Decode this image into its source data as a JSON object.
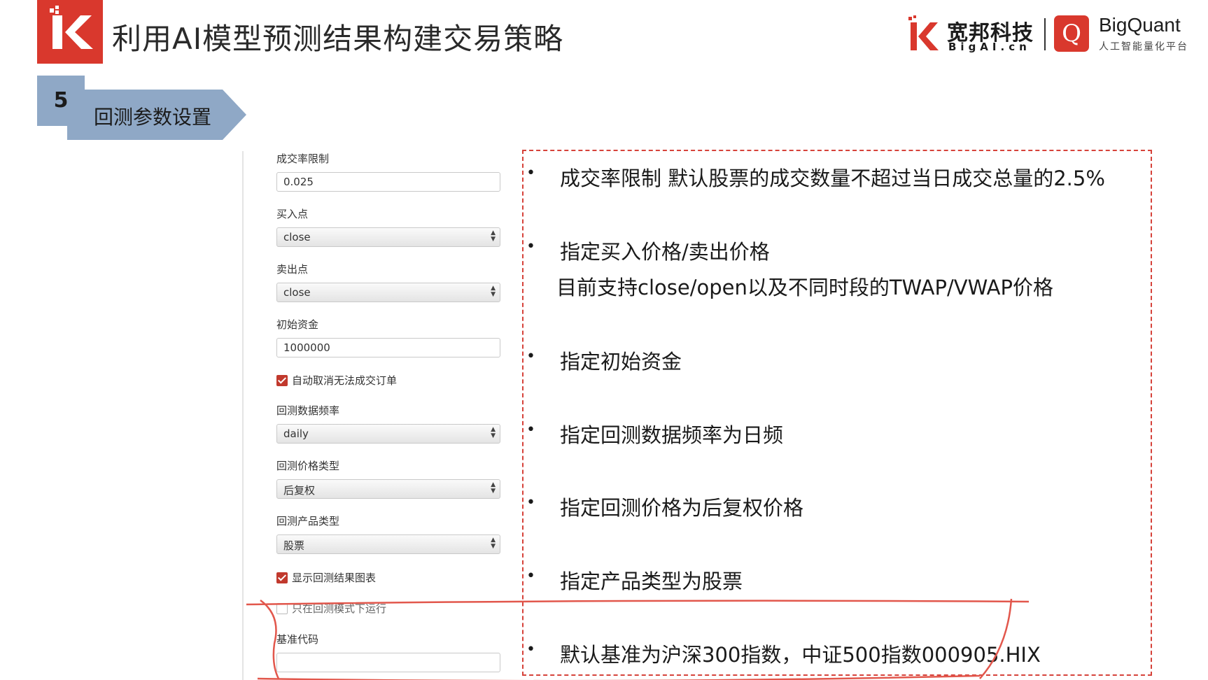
{
  "header": {
    "title": "利用AI模型预测结果构建交易策略",
    "brand_cn": "宽邦科技",
    "brand_en": "BigAI.cn",
    "brand2_letter": "Q",
    "brand2_name": "BigQuant",
    "brand2_sub": "人工智能量化平台"
  },
  "section": {
    "number": "5",
    "label": "回测参数设置"
  },
  "form": {
    "fill_rate_label": "成交率限制",
    "fill_rate_value": "0.025",
    "buy_point_label": "买入点",
    "buy_point_value": "close",
    "sell_point_label": "卖出点",
    "sell_point_value": "close",
    "initial_capital_label": "初始资金",
    "initial_capital_value": "1000000",
    "auto_cancel_label": "自动取消无法成交订单",
    "auto_cancel_checked": true,
    "data_frequency_label": "回测数据频率",
    "data_frequency_value": "daily",
    "price_type_label": "回测价格类型",
    "price_type_value": "后复权",
    "product_type_label": "回测产品类型",
    "product_type_value": "股票",
    "show_chart_label": "显示回测结果图表",
    "show_chart_checked": true,
    "backtest_only_label": "只在回测模式下运行",
    "backtest_only_checked": false,
    "benchmark_label": "基准代码",
    "benchmark_value": ""
  },
  "descriptions": {
    "bullet_symbol": "•",
    "fill_rate": "成交率限制 默认股票的成交数量不超过当日成交总量的2.5%",
    "price_points": "指定买入价格/卖出价格",
    "price_points_detail": "目前支持close/open以及不同时段的TWAP/VWAP价格",
    "initial_capital": "指定初始资金",
    "data_frequency": "指定回测数据频率为日频",
    "price_type": "指定回测价格为后复权价格",
    "product_type": "指定产品类型为股票",
    "benchmark": "默认基准为沪深300指数，中证500指数000905.HIX"
  },
  "colors": {
    "brand_red": "#d9382d",
    "section_blue": "#8fa8c6",
    "dash_red": "#d6423a",
    "annotation_red": "#e2574c"
  }
}
